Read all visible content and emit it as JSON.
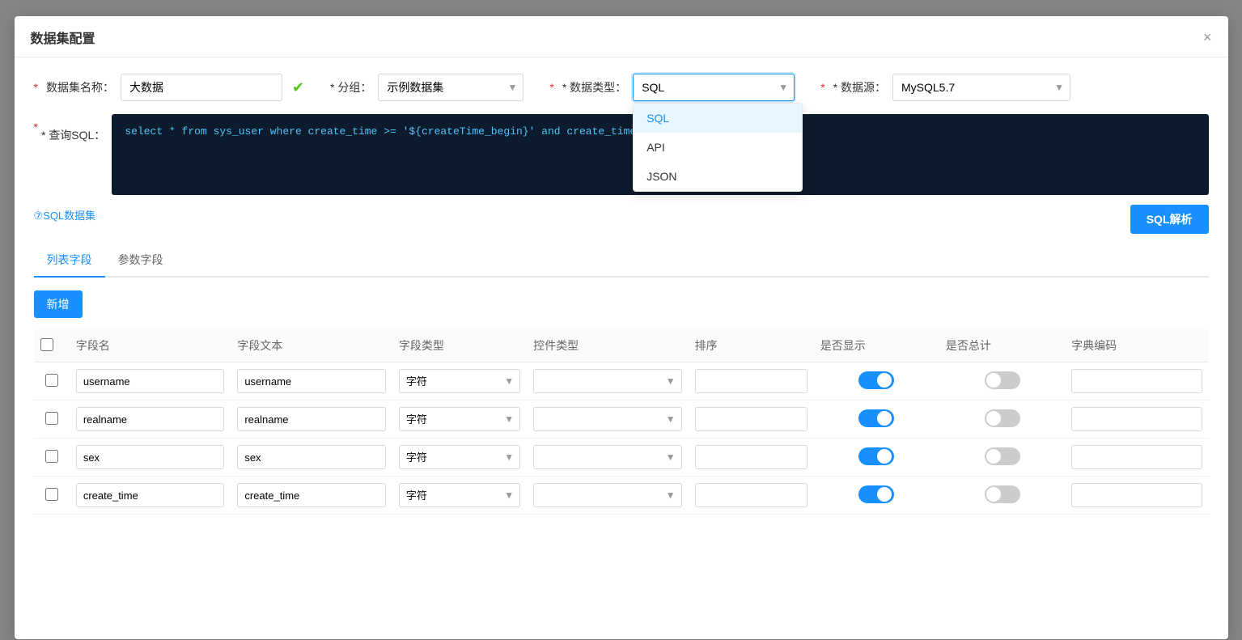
{
  "dialog": {
    "title": "数据集配置",
    "close_label": "×"
  },
  "form": {
    "name_label": "数据集名称：",
    "name_value": "大数据",
    "group_label": "* 分组：",
    "group_value": "示例数据集",
    "type_label": "* 数据类型：",
    "type_value": "SQL",
    "source_label": "* 数据源：",
    "source_value": "MySQL5.7",
    "sql_label": "* 查询SQL：",
    "sql_code": "select * from sys_user where create_time >= '${createTime_begin}' and create_time <= '${create"
  },
  "type_dropdown": {
    "options": [
      {
        "label": "SQL",
        "value": "SQL",
        "selected": true
      },
      {
        "label": "API",
        "value": "API",
        "selected": false
      },
      {
        "label": "JSON",
        "value": "JSON",
        "selected": false
      }
    ]
  },
  "sql_info_link": "⑦SQL数据集",
  "sql_analyze_btn": "SQL解析",
  "tabs": [
    {
      "label": "列表字段",
      "active": true
    },
    {
      "label": "参数字段",
      "active": false
    }
  ],
  "add_btn": "新增",
  "table": {
    "headers": [
      "",
      "字段名",
      "字段文本",
      "字段类型",
      "控件类型",
      "排序",
      "是否显示",
      "是否总计",
      "字典编码"
    ],
    "rows": [
      {
        "fieldname": "username",
        "fieldtext": "username",
        "fieldtype": "字符",
        "ctrltype": "",
        "sort": "",
        "show": true,
        "total": false,
        "dict": ""
      },
      {
        "fieldname": "realname",
        "fieldtext": "realname",
        "fieldtype": "字符",
        "ctrltype": "",
        "sort": "",
        "show": true,
        "total": false,
        "dict": ""
      },
      {
        "fieldname": "sex",
        "fieldtext": "sex",
        "fieldtype": "字符",
        "ctrltype": "",
        "sort": "",
        "show": true,
        "total": false,
        "dict": ""
      },
      {
        "fieldname": "create_time",
        "fieldtext": "create_time",
        "fieldtype": "字符",
        "ctrltype": "",
        "sort": "",
        "show": true,
        "total": false,
        "dict": ""
      }
    ]
  }
}
